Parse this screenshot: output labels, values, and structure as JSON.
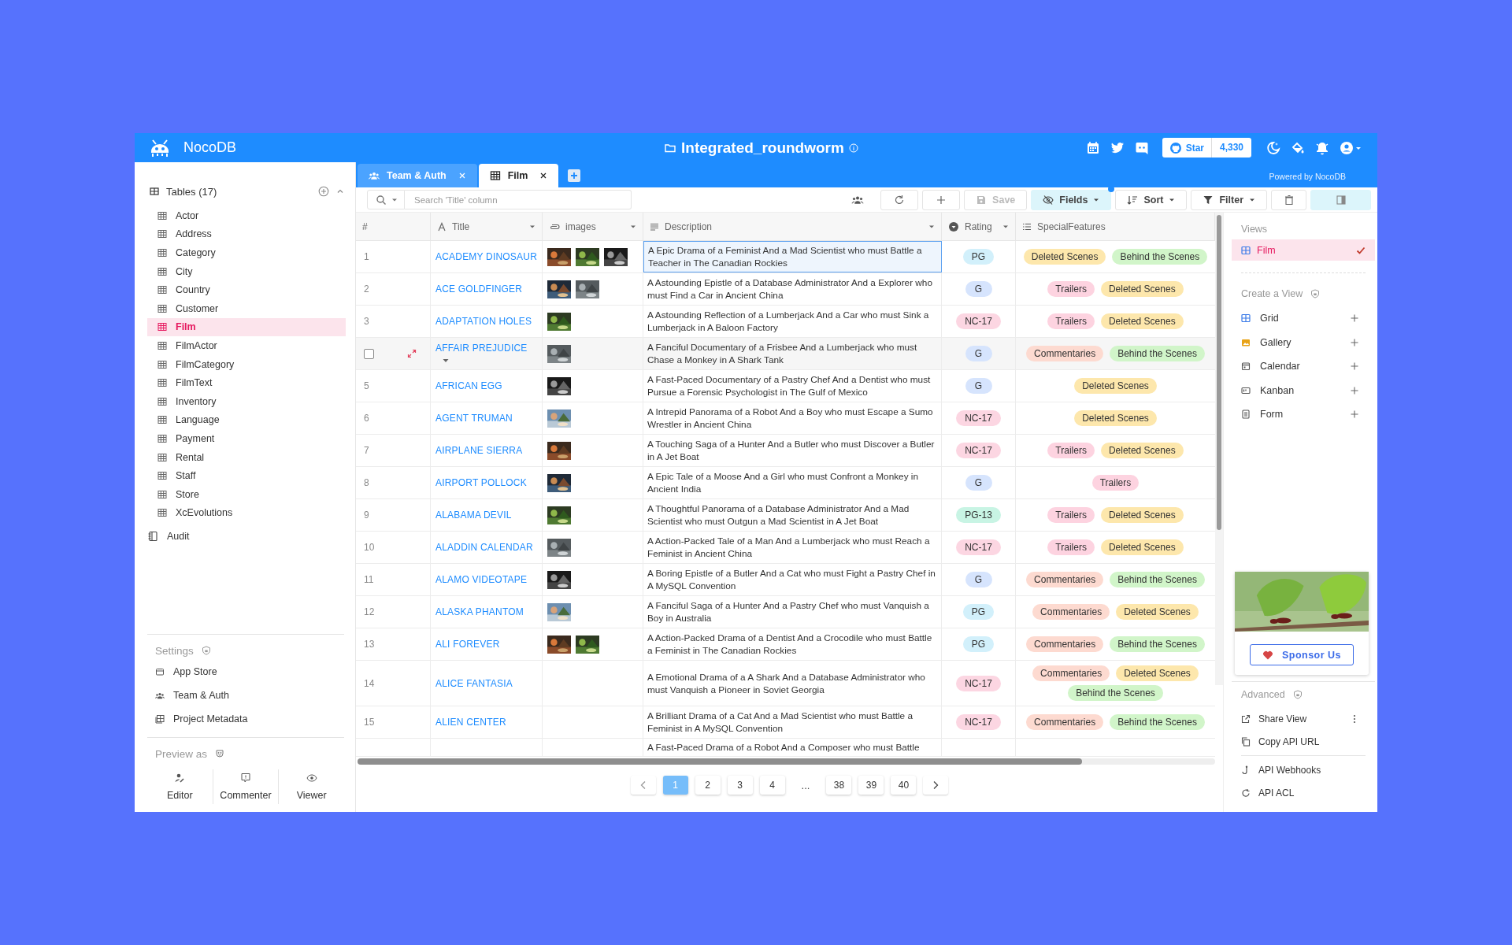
{
  "app": {
    "name": "NocoDB"
  },
  "project": {
    "title": "Integrated_roundworm"
  },
  "github": {
    "label": "Star",
    "count": "4,330"
  },
  "powered_by": "Powered by NocoDB",
  "tabs": [
    {
      "label": "Team & Auth",
      "kind": "team",
      "selected": false
    },
    {
      "label": "Film",
      "kind": "table",
      "selected": true
    }
  ],
  "sidebar": {
    "tables_header": "Tables (17)",
    "tables": [
      {
        "label": "Actor",
        "selected": false
      },
      {
        "label": "Address",
        "selected": false
      },
      {
        "label": "Category",
        "selected": false
      },
      {
        "label": "City",
        "selected": false
      },
      {
        "label": "Country",
        "selected": false
      },
      {
        "label": "Customer",
        "selected": false
      },
      {
        "label": "Film",
        "selected": true
      },
      {
        "label": "FilmActor",
        "selected": false
      },
      {
        "label": "FilmCategory",
        "selected": false
      },
      {
        "label": "FilmText",
        "selected": false
      },
      {
        "label": "Inventory",
        "selected": false
      },
      {
        "label": "Language",
        "selected": false
      },
      {
        "label": "Payment",
        "selected": false
      },
      {
        "label": "Rental",
        "selected": false
      },
      {
        "label": "Staff",
        "selected": false
      },
      {
        "label": "Store",
        "selected": false
      },
      {
        "label": "XcEvolutions",
        "selected": false
      }
    ],
    "audit": "Audit",
    "settings": {
      "title": "Settings",
      "items": [
        {
          "label": "App Store",
          "kind": "store"
        },
        {
          "label": "Team & Auth",
          "kind": "team"
        },
        {
          "label": "Project Metadata",
          "kind": "metadata"
        }
      ]
    },
    "preview": {
      "title": "Preview as",
      "roles": [
        {
          "label": "Editor",
          "kind": "editor"
        },
        {
          "label": "Commenter",
          "kind": "commenter"
        },
        {
          "label": "Viewer",
          "kind": "viewer"
        }
      ]
    }
  },
  "toolbar": {
    "search_placeholder": "Search 'Title' column",
    "buttons": [
      {
        "kind": "reload",
        "on": false,
        "disabled": false,
        "dot": false
      },
      {
        "kind": "add",
        "on": false,
        "disabled": false,
        "dot": false
      },
      {
        "kind": "save",
        "label": "Save",
        "on": false,
        "disabled": true,
        "dot": false
      },
      {
        "kind": "fields",
        "label": "Fields",
        "on": true,
        "disabled": false,
        "dot": true
      },
      {
        "kind": "sort",
        "label": "Sort",
        "on": false,
        "disabled": false,
        "dot": false
      },
      {
        "kind": "filter",
        "label": "Filter",
        "on": false,
        "disabled": false,
        "dot": false
      },
      {
        "kind": "delete",
        "on": false,
        "disabled": false,
        "dot": false
      },
      {
        "kind": "panel",
        "on": true,
        "disabled": false,
        "dot": false
      }
    ]
  },
  "table": {
    "columns": [
      {
        "label": "#",
        "kind": "number"
      },
      {
        "label": "Title",
        "kind": "title"
      },
      {
        "label": "images",
        "kind": "images"
      },
      {
        "label": "Description",
        "kind": "description"
      },
      {
        "label": "Rating",
        "kind": "rating"
      },
      {
        "label": "SpecialFeatures",
        "kind": "features"
      }
    ],
    "rows": [
      {
        "number": "1",
        "hovered": false,
        "checked": false,
        "title": "ACADEMY DINOSAUR",
        "images": [
          {
            "kind": "picture"
          },
          {
            "kind": "picture"
          },
          {
            "kind": "picture"
          }
        ],
        "description": "A Epic Drama of a Feminist And a Mad Scientist who must Battle a Teacher in The Canadian Rockies",
        "description_selected": true,
        "rating": {
          "label": "PG",
          "color": "#d2f0fb"
        },
        "features": [
          {
            "label": "Deleted Scenes",
            "color": "#fde7ac"
          },
          {
            "label": "Behind the Scenes",
            "color": "#d1f5c9"
          }
        ]
      },
      {
        "number": "2",
        "hovered": false,
        "checked": false,
        "title": "ACE GOLDFINGER",
        "images": [
          {
            "kind": "picture"
          },
          {
            "kind": "picture"
          }
        ],
        "description": "A Astounding Epistle of a Database Administrator And a Explorer who must Find a Car in Ancient China",
        "description_selected": false,
        "rating": {
          "label": "G",
          "color": "#d6e4fd"
        },
        "features": [
          {
            "label": "Trailers",
            "color": "#fdd3e0"
          },
          {
            "label": "Deleted Scenes",
            "color": "#fde7ac"
          }
        ]
      },
      {
        "number": "3",
        "hovered": false,
        "checked": false,
        "title": "ADAPTATION HOLES",
        "images": [
          {
            "kind": "picture"
          }
        ],
        "description": "A Astounding Reflection of a Lumberjack And a Car who must Sink a Lumberjack in A Baloon Factory",
        "description_selected": false,
        "rating": {
          "label": "NC-17",
          "color": "#fcd6e2"
        },
        "features": [
          {
            "label": "Trailers",
            "color": "#fdd3e0"
          },
          {
            "label": "Deleted Scenes",
            "color": "#fde7ac"
          }
        ]
      },
      {
        "hovered": true,
        "checked": false,
        "title": "AFFAIR PREJUDICE",
        "images": [
          {
            "kind": "picture"
          }
        ],
        "description": "A Fanciful Documentary of a Frisbee And a Lumberjack who must Chase a Monkey in A Shark Tank",
        "description_selected": false,
        "rating": {
          "label": "G",
          "color": "#d6e4fd"
        },
        "features": [
          {
            "label": "Commentaries",
            "color": "#fddad0"
          },
          {
            "label": "Behind the Scenes",
            "color": "#d1f5c9"
          }
        ]
      },
      {
        "number": "5",
        "hovered": false,
        "checked": false,
        "title": "AFRICAN EGG",
        "images": [
          {
            "kind": "picture"
          }
        ],
        "description": "A Fast-Paced Documentary of a Pastry Chef And a Dentist who must Pursue a Forensic Psychologist in The Gulf of Mexico",
        "description_selected": false,
        "rating": {
          "label": "G",
          "color": "#d6e4fd"
        },
        "features": [
          {
            "label": "Deleted Scenes",
            "color": "#fde7ac"
          }
        ]
      },
      {
        "number": "6",
        "hovered": false,
        "checked": false,
        "title": "AGENT TRUMAN",
        "images": [
          {
            "kind": "picture"
          }
        ],
        "description": "A Intrepid Panorama of a Robot And a Boy who must Escape a Sumo Wrestler in Ancient China",
        "description_selected": false,
        "rating": {
          "label": "NC-17",
          "color": "#fcd6e2"
        },
        "features": [
          {
            "label": "Deleted Scenes",
            "color": "#fde7ac"
          }
        ]
      },
      {
        "number": "7",
        "hovered": false,
        "checked": false,
        "title": "AIRPLANE SIERRA",
        "images": [
          {
            "kind": "picture"
          }
        ],
        "description": "A Touching Saga of a Hunter And a Butler who must Discover a Butler in A Jet Boat",
        "description_selected": false,
        "rating": {
          "label": "NC-17",
          "color": "#fcd6e2"
        },
        "features": [
          {
            "label": "Trailers",
            "color": "#fdd3e0"
          },
          {
            "label": "Deleted Scenes",
            "color": "#fde7ac"
          }
        ]
      },
      {
        "number": "8",
        "hovered": false,
        "checked": false,
        "title": "AIRPORT POLLOCK",
        "images": [
          {
            "kind": "picture"
          }
        ],
        "description": "A Epic Tale of a Moose And a Girl who must Confront a Monkey in Ancient India",
        "description_selected": false,
        "rating": {
          "label": "G",
          "color": "#d6e4fd"
        },
        "features": [
          {
            "label": "Trailers",
            "color": "#fdd3e0"
          }
        ]
      },
      {
        "number": "9",
        "hovered": false,
        "checked": false,
        "title": "ALABAMA DEVIL",
        "images": [
          {
            "kind": "picture"
          }
        ],
        "description": "A Thoughtful Panorama of a Database Administrator And a Mad Scientist who must Outgun a Mad Scientist in A Jet Boat",
        "description_selected": false,
        "rating": {
          "label": "PG-13",
          "color": "#c8f4e4"
        },
        "features": [
          {
            "label": "Trailers",
            "color": "#fdd3e0"
          },
          {
            "label": "Deleted Scenes",
            "color": "#fde7ac"
          }
        ]
      },
      {
        "number": "10",
        "hovered": false,
        "checked": false,
        "title": "ALADDIN CALENDAR",
        "images": [
          {
            "kind": "picture"
          }
        ],
        "description": "A Action-Packed Tale of a Man And a Lumberjack who must Reach a Feminist in Ancient China",
        "description_selected": false,
        "rating": {
          "label": "NC-17",
          "color": "#fcd6e2"
        },
        "features": [
          {
            "label": "Trailers",
            "color": "#fdd3e0"
          },
          {
            "label": "Deleted Scenes",
            "color": "#fde7ac"
          }
        ]
      },
      {
        "number": "11",
        "hovered": false,
        "checked": false,
        "title": "ALAMO VIDEOTAPE",
        "images": [
          {
            "kind": "picture"
          }
        ],
        "description": "A Boring Epistle of a Butler And a Cat who must Fight a Pastry Chef in A MySQL Convention",
        "description_selected": false,
        "rating": {
          "label": "G",
          "color": "#d6e4fd"
        },
        "features": [
          {
            "label": "Commentaries",
            "color": "#fddad0"
          },
          {
            "label": "Behind the Scenes",
            "color": "#d1f5c9"
          }
        ]
      },
      {
        "number": "12",
        "hovered": false,
        "checked": false,
        "title": "ALASKA PHANTOM",
        "images": [
          {
            "kind": "picture"
          }
        ],
        "description": "A Fanciful Saga of a Hunter And a Pastry Chef who must Vanquish a Boy in Australia",
        "description_selected": false,
        "rating": {
          "label": "PG",
          "color": "#d2f0fb"
        },
        "features": [
          {
            "label": "Commentaries",
            "color": "#fddad0"
          },
          {
            "label": "Deleted Scenes",
            "color": "#fde7ac"
          }
        ]
      },
      {
        "number": "13",
        "hovered": false,
        "checked": false,
        "title": "ALI FOREVER",
        "images": [
          {
            "kind": "picture"
          },
          {
            "kind": "picture"
          }
        ],
        "description": "A Action-Packed Drama of a Dentist And a Crocodile who must Battle a Feminist in The Canadian Rockies",
        "description_selected": false,
        "rating": {
          "label": "PG",
          "color": "#d2f0fb"
        },
        "features": [
          {
            "label": "Commentaries",
            "color": "#fddad0"
          },
          {
            "label": "Behind the Scenes",
            "color": "#d1f5c9"
          }
        ]
      },
      {
        "number": "14",
        "hovered": false,
        "checked": false,
        "title": "ALICE FANTASIA",
        "description": "A Emotional Drama of a A Shark And a Database Administrator who must Vanquish a Pioneer in Soviet Georgia",
        "description_selected": false,
        "rating": {
          "label": "NC-17",
          "color": "#fcd6e2"
        },
        "features": [
          {
            "label": "Commentaries",
            "color": "#fddad0"
          },
          {
            "label": "Deleted Scenes",
            "color": "#fde7ac"
          },
          {
            "label": "Behind the Scenes",
            "color": "#d1f5c9"
          }
        ]
      },
      {
        "number": "15",
        "hovered": false,
        "checked": false,
        "title": "ALIEN CENTER",
        "description": "A Brilliant Drama of a Cat And a Mad Scientist who must Battle a Feminist in A MySQL Convention",
        "description_selected": false,
        "rating": {
          "label": "NC-17",
          "color": "#fcd6e2"
        },
        "features": [
          {
            "label": "Commentaries",
            "color": "#fddad0"
          },
          {
            "label": "Behind the Scenes",
            "color": "#d1f5c9"
          }
        ]
      },
      {
        "hovered": false,
        "checked": false,
        "description": "A Fast-Paced Drama of a Robot And a Composer who must Battle",
        "description_selected": false
      }
    ]
  },
  "pagination": [
    {
      "label": "1",
      "kind": "page",
      "selected": true
    },
    {
      "label": "2",
      "kind": "page",
      "selected": false
    },
    {
      "label": "3",
      "kind": "page",
      "selected": false
    },
    {
      "label": "4",
      "kind": "page",
      "selected": false
    },
    {
      "label": "...",
      "kind": "ellipsis",
      "selected": false
    },
    {
      "label": "38",
      "kind": "page",
      "selected": false
    },
    {
      "label": "39",
      "kind": "page",
      "selected": false
    },
    {
      "label": "40",
      "kind": "page",
      "selected": false
    }
  ],
  "right_panel": {
    "views": {
      "title": "Views",
      "items": [
        {
          "label": "Film",
          "kind": "grid",
          "selected": true
        }
      ]
    },
    "create": {
      "title": "Create a View",
      "items": [
        {
          "label": "Grid",
          "kind": "grid"
        },
        {
          "label": "Gallery",
          "kind": "gallery"
        },
        {
          "label": "Calendar",
          "kind": "calendar"
        },
        {
          "label": "Kanban",
          "kind": "kanban"
        },
        {
          "label": "Form",
          "kind": "form"
        }
      ]
    },
    "sponsor": {
      "picture": {
        "kind": "picture"
      },
      "button": "Sponsor Us"
    },
    "advanced": {
      "title": "Advanced",
      "groups": [
        [
          {
            "label": "Share View",
            "kind": "share",
            "menu": true
          },
          {
            "label": "Copy API URL",
            "kind": "copy",
            "menu": false
          }
        ],
        [
          {
            "label": "API Webhooks",
            "kind": "webhook",
            "menu": false
          },
          {
            "label": "API ACL",
            "kind": "acl",
            "menu": false
          }
        ]
      ]
    }
  }
}
